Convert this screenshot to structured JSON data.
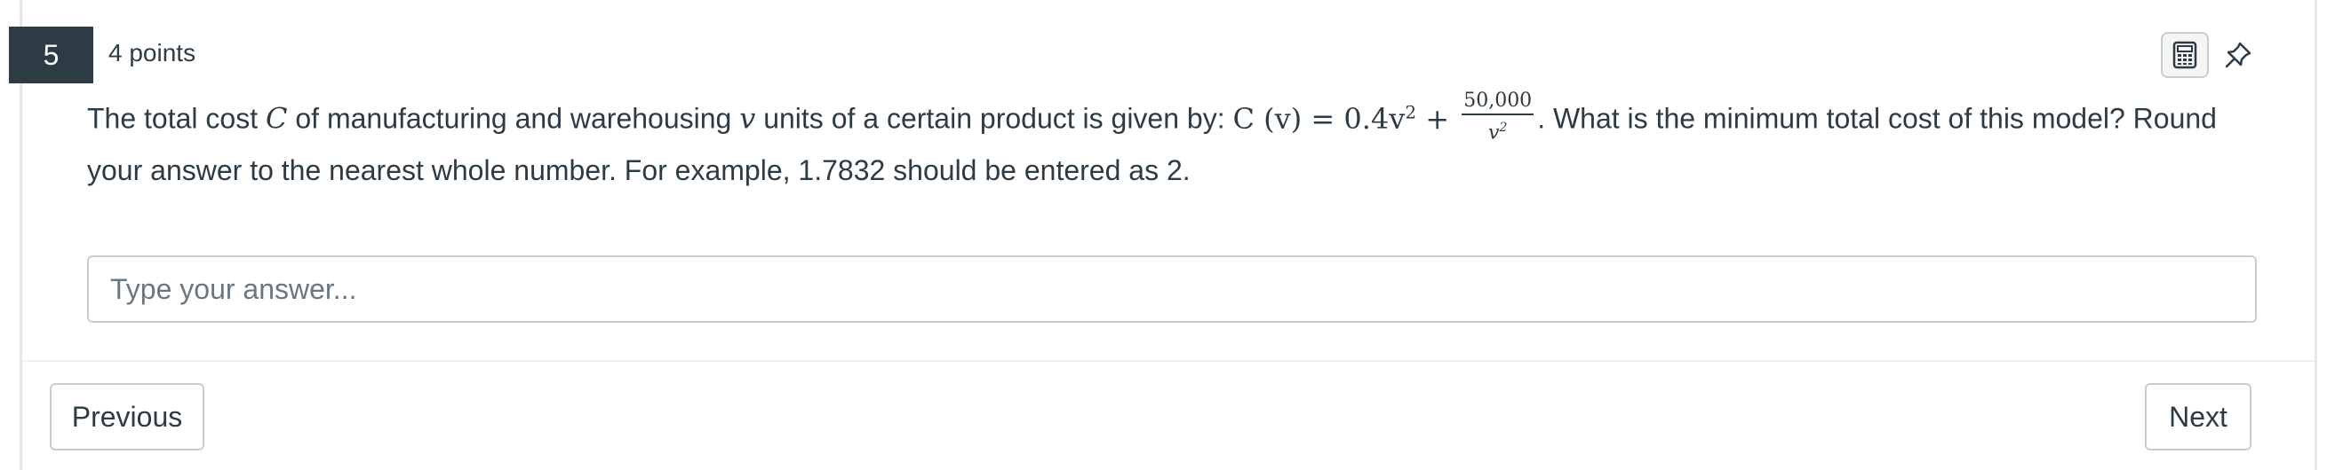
{
  "question": {
    "number": "5",
    "points": "4 points",
    "text_part1": "The total cost ",
    "var_c": "C",
    "text_part2": " of manufacturing and warehousing ",
    "var_v": "v",
    "text_part3": " units of a certain product is given by: ",
    "formula_lhs": "C (v) = 0.4v",
    "formula_exp": "2",
    "formula_plus": " + ",
    "frac_num": "50,000",
    "frac_den_var": "v",
    "frac_den_exp": "2",
    "text_part4": ". What is the minimum total cost of this model? Round your answer to the nearest whole number. For example, 1.7832 should be entered as 2."
  },
  "tools": {
    "calculator_icon": "calculator-icon",
    "pin_icon": "pin-icon"
  },
  "answer": {
    "placeholder": "Type your answer...",
    "value": ""
  },
  "nav": {
    "previous_label": "Previous",
    "next_label": "Next"
  },
  "colors": {
    "badge_bg": "#2d3b45",
    "text": "#2d3b45",
    "border": "#c7cdd1"
  }
}
